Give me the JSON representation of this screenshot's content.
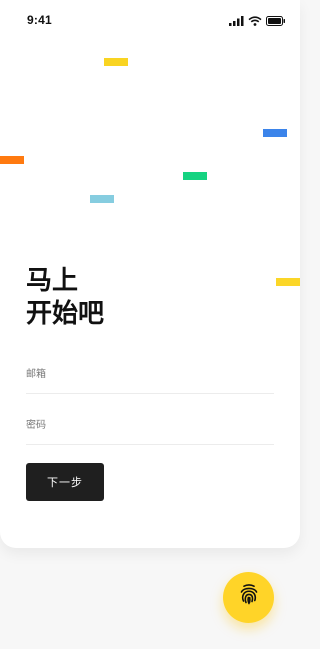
{
  "status_bar": {
    "time": "9:41",
    "icons": [
      "signal-icon",
      "wifi-icon",
      "battery-icon"
    ]
  },
  "confetti_colors": [
    "#f9d422",
    "#3b84ea",
    "#ff7a10",
    "#15d381",
    "#86cde0",
    "#fbd628"
  ],
  "headline": {
    "line1": "马上",
    "line2": "开始吧"
  },
  "form": {
    "email_label": "邮箱",
    "password_label": "密码",
    "email_value": "",
    "password_value": "",
    "next_label": "下一步"
  },
  "fingerprint_button": {
    "icon": "fingerprint-icon",
    "color": "#ffd428"
  }
}
